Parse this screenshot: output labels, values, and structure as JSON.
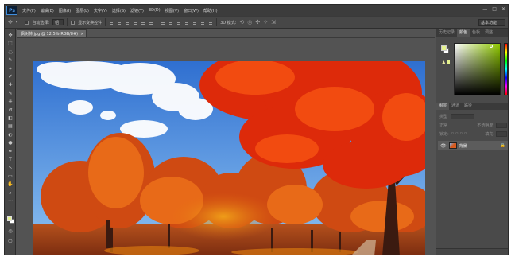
{
  "app": {
    "logo": "Ps"
  },
  "menubar": {
    "items": [
      "文件(F)",
      "编辑(E)",
      "图像(I)",
      "图层(L)",
      "文字(Y)",
      "选择(S)",
      "滤镜(T)",
      "3D(D)",
      "视图(V)",
      "窗口(W)",
      "帮助(H)"
    ],
    "window_controls": [
      "—",
      "□",
      "✕"
    ]
  },
  "options": {
    "auto_select_label": "自动选择:",
    "auto_select_value": "组",
    "show_transform_label": "显示变换控件",
    "mode_3d_label": "3D 模式:",
    "workspace": "基本功能"
  },
  "document": {
    "tab_title": "枫树林.jpg @ 12.5%(RGB/8#)",
    "tab_close": "×"
  },
  "tools": {
    "icons": [
      "move-icon",
      "marquee-icon",
      "lasso-icon",
      "quick-select-icon",
      "crop-icon",
      "eyedropper-icon",
      "healing-icon",
      "brush-icon",
      "stamp-icon",
      "history-brush-icon",
      "eraser-icon",
      "gradient-icon",
      "blur-icon",
      "dodge-icon",
      "pen-icon",
      "type-icon",
      "path-select-icon",
      "shape-icon",
      "hand-icon",
      "zoom-icon",
      "edit-toolbar-icon"
    ],
    "glyphs": [
      "✥",
      "⬚",
      "◌",
      "✎",
      "⌗",
      "✐",
      "✚",
      "✎",
      "⎈",
      "↺",
      "◧",
      "▤",
      "◐",
      "●",
      "✒",
      "T",
      "↖",
      "▭",
      "✋",
      "⌕",
      "⋯"
    ],
    "foreground_color": "#e4f28e",
    "background_color": "#ffffff"
  },
  "color_panel": {
    "tabs": [
      "历史记录",
      "颜色",
      "色板",
      "调整"
    ],
    "active_tab": 1
  },
  "layers_panel": {
    "tabs": [
      "图层",
      "通道",
      "路径"
    ],
    "active_tab": 0,
    "kind_filter": "类型",
    "blend_mode": "正常",
    "opacity_label": "不透明度:",
    "lock_label": "锁定:",
    "fill_label": "填充:",
    "layers": [
      {
        "name": "背景",
        "visible": true,
        "locked": true
      }
    ]
  }
}
